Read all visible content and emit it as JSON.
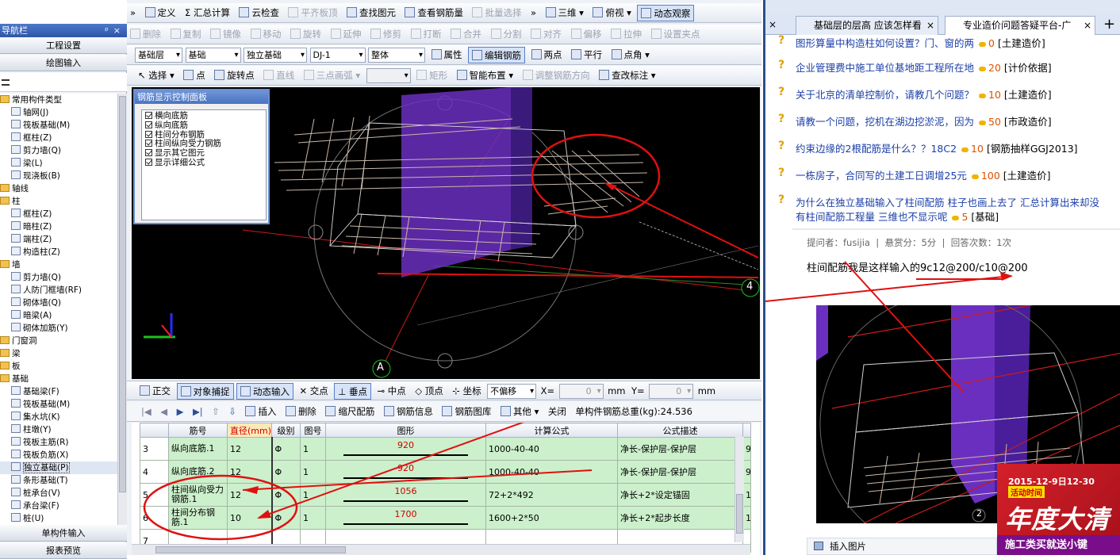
{
  "nav": {
    "title": "导航栏",
    "pin": "ᵖ",
    "close": "×",
    "top_buttons": [
      "工程设置",
      "绘图输入"
    ],
    "bottom_buttons": [
      "单构件输入",
      "报表预览"
    ],
    "tree": [
      {
        "label": "常用构件类型",
        "level": 0,
        "folder": true
      },
      {
        "label": "轴网(J)",
        "level": 1
      },
      {
        "label": "筏板基础(M)",
        "level": 1
      },
      {
        "label": "框柱(Z)",
        "level": 1
      },
      {
        "label": "剪力墙(Q)",
        "level": 1
      },
      {
        "label": "梁(L)",
        "level": 1
      },
      {
        "label": "现浇板(B)",
        "level": 1
      },
      {
        "label": "轴线",
        "level": 0,
        "folder": true
      },
      {
        "label": "柱",
        "level": 0,
        "folder": true
      },
      {
        "label": "框柱(Z)",
        "level": 1
      },
      {
        "label": "暗柱(Z)",
        "level": 1
      },
      {
        "label": "端柱(Z)",
        "level": 1
      },
      {
        "label": "构造柱(Z)",
        "level": 1
      },
      {
        "label": "墙",
        "level": 0,
        "folder": true
      },
      {
        "label": "剪力墙(Q)",
        "level": 1
      },
      {
        "label": "人防门框墙(RF)",
        "level": 1
      },
      {
        "label": "砌体墙(Q)",
        "level": 1
      },
      {
        "label": "暗梁(A)",
        "level": 1
      },
      {
        "label": "砌体加筋(Y)",
        "level": 1
      },
      {
        "label": "门窗洞",
        "level": 0,
        "folder": true
      },
      {
        "label": "梁",
        "level": 0,
        "folder": true
      },
      {
        "label": "板",
        "level": 0,
        "folder": true
      },
      {
        "label": "基础",
        "level": 0,
        "folder": true
      },
      {
        "label": "基础梁(F)",
        "level": 1
      },
      {
        "label": "筏板基础(M)",
        "level": 1
      },
      {
        "label": "集水坑(K)",
        "level": 1
      },
      {
        "label": "柱墩(Y)",
        "level": 1
      },
      {
        "label": "筏板主筋(R)",
        "level": 1
      },
      {
        "label": "筏板负筋(X)",
        "level": 1
      },
      {
        "label": "独立基础(P)",
        "level": 1,
        "selected": true
      },
      {
        "label": "条形基础(T)",
        "level": 1
      },
      {
        "label": "桩承台(V)",
        "level": 1
      },
      {
        "label": "承台梁(F)",
        "level": 1
      },
      {
        "label": "桩(U)",
        "level": 1
      }
    ]
  },
  "toolbar1": [
    "定义",
    "Σ 汇总计算",
    "云检查",
    "平齐板顶",
    "查找图元",
    "查看钢筋量",
    "批量选择",
    "三维",
    "俯视",
    "动态观察"
  ],
  "toolbar2": [
    "删除",
    "复制",
    "镜像",
    "移动",
    "旋转",
    "延伸",
    "修剪",
    "打断",
    "合并",
    "分割",
    "对齐",
    "偏移",
    "拉伸",
    "设置夹点"
  ],
  "toolbar3": {
    "selects": [
      "基础层",
      "基础",
      "独立基础",
      "DJ-1",
      "整体"
    ],
    "buttons": [
      "属性",
      "编辑钢筋",
      "两点",
      "平行",
      "点角"
    ]
  },
  "toolbar4": [
    "选择",
    "点",
    "旋转点",
    "直线",
    "三点画弧",
    "矩形",
    "智能布置",
    "调整钢筋方向",
    "查改标注"
  ],
  "control_panel": {
    "title": "钢筋显示控制面板",
    "items": [
      "横向底筋",
      "纵向底筋",
      "柱间分布钢筋",
      "柱间纵向受力钢筋",
      "显示其它图元",
      "显示详细公式"
    ]
  },
  "viewport_labels": {
    "axis_a": "A",
    "axis_4": "4"
  },
  "snapbar": {
    "items": [
      "正交",
      "对象捕捉",
      "动态输入",
      "交点",
      "垂点",
      "中点",
      "顶点",
      "坐标"
    ],
    "offset_mode": "不偏移",
    "x_label": "X=",
    "x_value": "0",
    "y_label": "Y=",
    "y_value": "0",
    "unit": "mm"
  },
  "grid_toolbar": {
    "items": [
      "插入",
      "删除",
      "缩尺配筋",
      "钢筋信息",
      "钢筋图库",
      "其他",
      "关闭"
    ],
    "total": "单构件钢筋总重(kg):24.536"
  },
  "rebar_table": {
    "headers": [
      "",
      "筋号",
      "直径(mm)",
      "级别",
      "图号",
      "图形",
      "计算公式",
      "公式描述",
      ""
    ],
    "rows": [
      {
        "no": "3",
        "name": "纵向底筋.1",
        "dia": "12",
        "grade": "Φ",
        "fig": "1",
        "shape": "920",
        "formula": "1000-40-40",
        "desc": "净长-保护层-保护层",
        "extra": "9"
      },
      {
        "no": "4",
        "name": "纵向底筋.2",
        "dia": "12",
        "grade": "Φ",
        "fig": "1",
        "shape": "920",
        "formula": "1000-40-40",
        "desc": "净长-保护层-保护层",
        "extra": "9"
      },
      {
        "no": "5",
        "name": "柱间纵向受力钢筋.1",
        "dia": "12",
        "grade": "Φ",
        "fig": "1",
        "shape": "1056",
        "formula": "72+2*492",
        "desc": "净长+2*设定锚固",
        "extra": "1"
      },
      {
        "no": "6",
        "name": "柱间分布钢筋.1",
        "dia": "10",
        "grade": "Φ",
        "fig": "1",
        "shape": "1700",
        "formula": "1600+2*50",
        "desc": "净长+2*起步长度",
        "extra": "1"
      },
      {
        "no": "7",
        "name": "",
        "dia": "",
        "grade": "",
        "fig": "",
        "shape": "",
        "formula": "",
        "desc": "",
        "extra": ""
      }
    ]
  },
  "browser": {
    "tabs": [
      "基础层的层高 应该怎样看",
      "专业造价问题答疑平台-广"
    ],
    "questions": [
      {
        "title": "图形算量中构造柱如何设置？门、窗的两",
        "score": "0",
        "cat": "[土建造价]"
      },
      {
        "title": "企业管理费中施工单位基地距工程所在地",
        "score": "20",
        "cat": "[计价依据]"
      },
      {
        "title": "关于北京的清单控制价，请教几个问题？",
        "score": "10",
        "cat": "[土建造价]"
      },
      {
        "title": "请教一个问题，挖机在湖边挖淤泥，因为",
        "score": "50",
        "cat": "[市政造价]"
      },
      {
        "title": "约束边缘的2根配筋是什么？？18C2",
        "score": "10",
        "cat": "[钢筋抽样GGJ2013]"
      },
      {
        "title": "一栋房子，合同写的土建工日调增25元",
        "score": "100",
        "cat": "[土建造价]"
      },
      {
        "title": "为什么在独立基础输入了柱间配筋 柱子也画上去了 汇总计算出来却没",
        "title2": "有柱间配筋工程量 三维也不显示呢",
        "score": "5",
        "cat": "[基础]"
      }
    ],
    "meta": "提问者：fusijia  |  悬赏分：5分  |  回答次数：1次",
    "body": "柱间配筋我是这样输入的9c12@200/c10@200",
    "ad_date": "2015-12-9日12-30",
    "ad_sub": "活动时间",
    "ad_big": "年度大清",
    "ad_bottom": "施工类买就送小键",
    "insert_image": "插入图片",
    "page_num": "2"
  },
  "colors": {
    "annotation_red": "#e01010",
    "row_green": "#ccf0cc",
    "title_blue": "#2d56a8",
    "link_blue": "#1a3ea8"
  }
}
